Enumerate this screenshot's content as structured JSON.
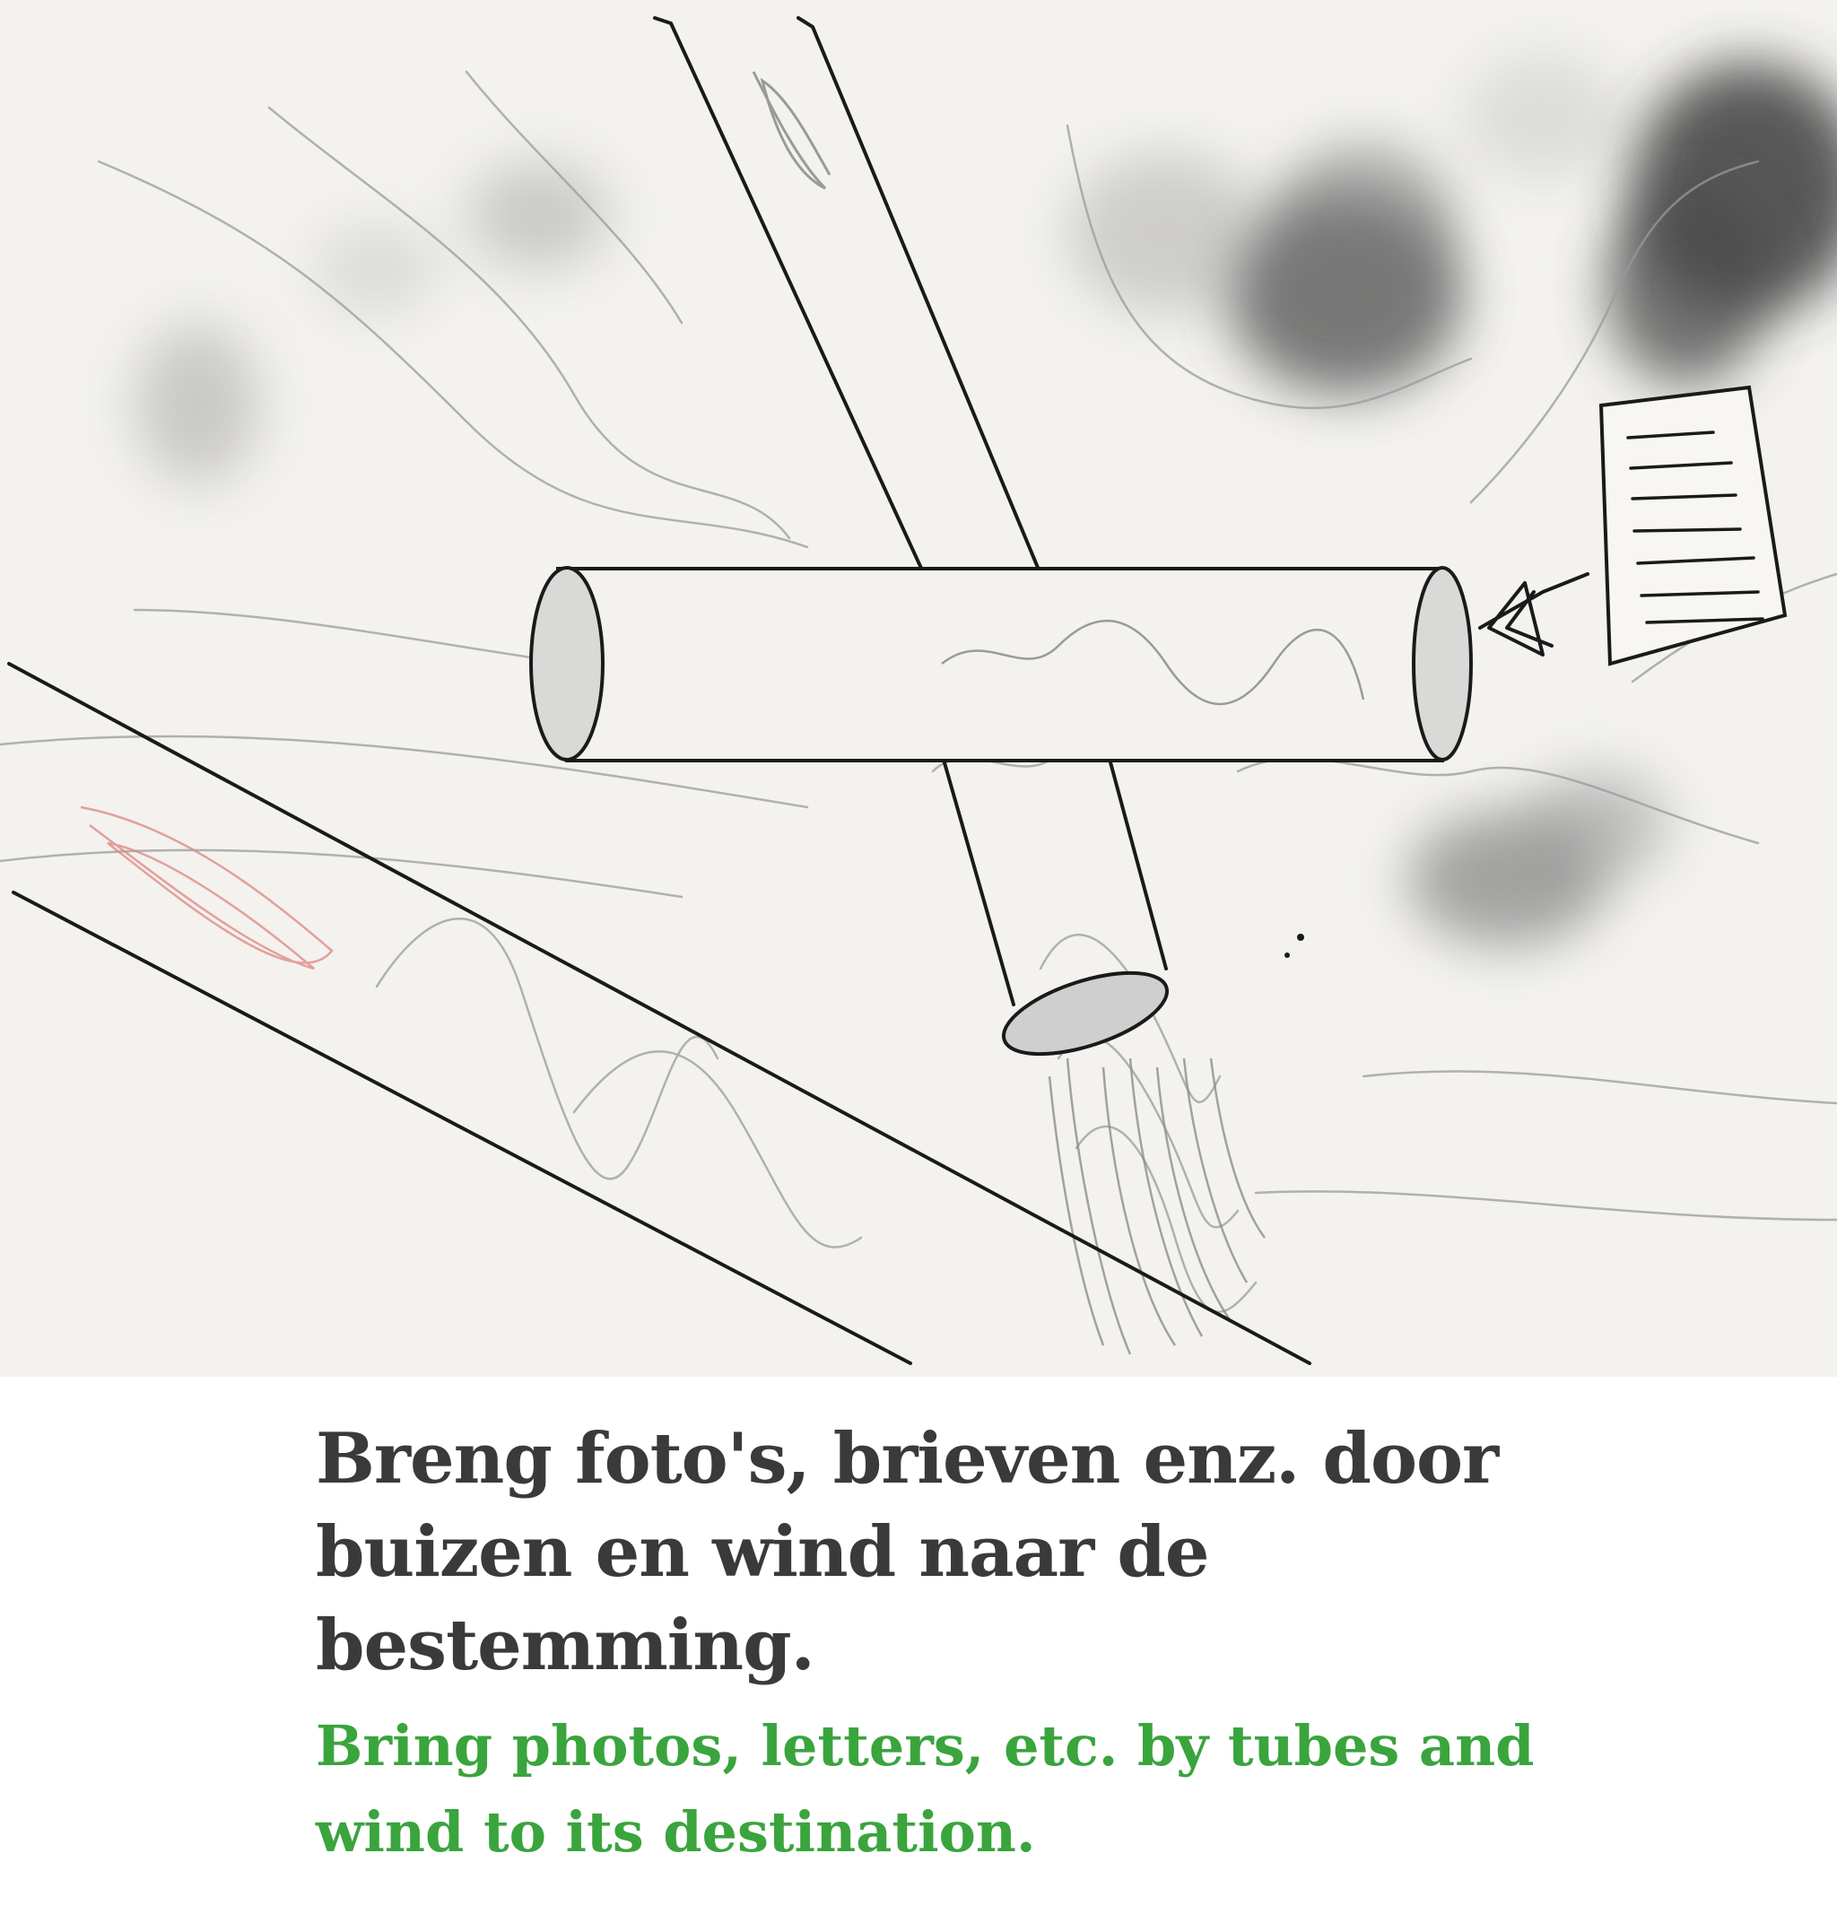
{
  "caption": {
    "dutch": "Breng foto's, brieven enz. door buizen en wind naar de bestemming.",
    "english": "Bring photos, letters, etc. by tubes and wind to its destination."
  },
  "colors": {
    "paper": "#f3f2ef",
    "ink": "#1a1a1a",
    "pencil": "#9a9a9a",
    "caption_dutch": "#3b3a38",
    "caption_english": "#3aa43d"
  },
  "illustration": {
    "elements": [
      "pneumatic-tube-horizontal",
      "pneumatic-tube-diagonal",
      "pneumatic-tube-vertical",
      "letter-document",
      "arrow-icon",
      "photo-in-tube",
      "smoke-clouds",
      "wind-scribbles"
    ]
  }
}
